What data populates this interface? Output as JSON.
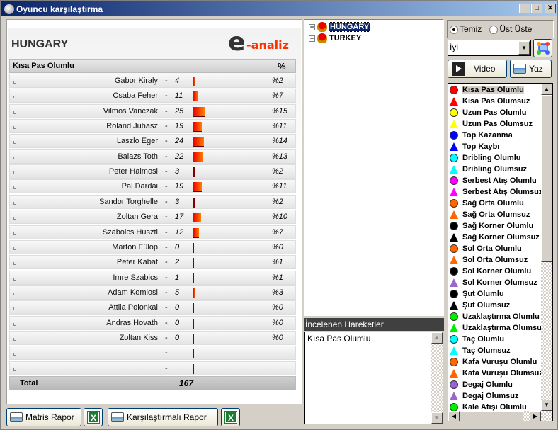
{
  "window": {
    "title": "Oyuncu karşılaştırma",
    "minimize": "_",
    "maximize": "□",
    "close": "✕"
  },
  "report": {
    "team": "HUNGARY",
    "logo_e": "e",
    "logo_text": "-analiz",
    "header": {
      "action": "Kısa Pas Olumlu",
      "pct": "%"
    },
    "rows": [
      {
        "name": "Gabor Kiraly",
        "value": "4",
        "pct": "%2"
      },
      {
        "name": "Csaba Feher",
        "value": "11",
        "pct": "%7"
      },
      {
        "name": "Vilmos Vanczak",
        "value": "25",
        "pct": "%15"
      },
      {
        "name": "Roland Juhasz",
        "value": "19",
        "pct": "%11"
      },
      {
        "name": "Laszlo Eger",
        "value": "24",
        "pct": "%14"
      },
      {
        "name": "Balazs Toth",
        "value": "22",
        "pct": "%13"
      },
      {
        "name": "Peter Halmosi",
        "value": "3",
        "pct": "%2"
      },
      {
        "name": "Pal Dardai",
        "value": "19",
        "pct": "%11"
      },
      {
        "name": "Sandor Torghelle",
        "value": "3",
        "pct": "%2"
      },
      {
        "name": "Zoltan Gera",
        "value": "17",
        "pct": "%10"
      },
      {
        "name": "Szabolcs Huszti",
        "value": "12",
        "pct": "%7"
      },
      {
        "name": "Marton Fülop",
        "value": "0",
        "pct": "%0"
      },
      {
        "name": "Peter Kabat",
        "value": "2",
        "pct": "%1"
      },
      {
        "name": "Imre Szabics",
        "value": "1",
        "pct": "%1"
      },
      {
        "name": "Adam Komlosi",
        "value": "5",
        "pct": "%3"
      },
      {
        "name": "Attila Polonkai",
        "value": "0",
        "pct": "%0"
      },
      {
        "name": "Andras Hovath",
        "value": "0",
        "pct": "%0"
      },
      {
        "name": "Zoltan Kiss",
        "value": "0",
        "pct": "%0"
      },
      {
        "name": "",
        "value": "",
        "pct": ""
      },
      {
        "name": "",
        "value": "",
        "pct": ""
      }
    ],
    "total_label": "Total",
    "total_value": "167",
    "dash": "-"
  },
  "buttons": {
    "matris": "Matris Rapor",
    "excel": "X",
    "karsilastirmali": "Karşılaştırmalı Rapor",
    "video": "Video",
    "yaz": "Yaz"
  },
  "tree": [
    {
      "label": "HUNGARY",
      "selected": true
    },
    {
      "label": "TURKEY",
      "selected": false
    }
  ],
  "tree_expand": "+",
  "incelenen": {
    "label": "İncelenen Hareketler",
    "items": [
      "Kısa Pas Olumlu"
    ]
  },
  "options": {
    "temiz": "Temiz",
    "ust_uste": "Üst Üste",
    "selected": "Temiz"
  },
  "combo": {
    "value": "İyi",
    "arrow": "▼"
  },
  "scroll": {
    "up": "▲",
    "down": "▼",
    "left": "◀",
    "right": "▶"
  },
  "actions": [
    {
      "label": "Kısa Pas Olumlu",
      "shape": "circle",
      "color": "#ff0000",
      "selected": true
    },
    {
      "label": "Kısa Pas Olumsuz",
      "shape": "triangle",
      "color": "#ff0000"
    },
    {
      "label": "Uzun Pas Olumlu",
      "shape": "circle",
      "color": "#ffff00"
    },
    {
      "label": "Uzun Pas Olumsuz",
      "shape": "triangle",
      "color": "#ffff00"
    },
    {
      "label": "Top Kazanma",
      "shape": "circle",
      "color": "#0000ff"
    },
    {
      "label": "Top Kaybı",
      "shape": "triangle",
      "color": "#0000ff"
    },
    {
      "label": "Dribling Olumlu",
      "shape": "circle",
      "color": "#00ffff"
    },
    {
      "label": "Dribling Olumsuz",
      "shape": "triangle",
      "color": "#00ffff"
    },
    {
      "label": "Serbest Atış Olumlu",
      "shape": "circle",
      "color": "#ff00ff"
    },
    {
      "label": "Serbest Atış Olumsuz",
      "shape": "triangle",
      "color": "#ff00ff"
    },
    {
      "label": "Sağ Orta Olumlu",
      "shape": "circle",
      "color": "#ff6600"
    },
    {
      "label": "Sağ Orta Olumsuz",
      "shape": "triangle",
      "color": "#ff6600"
    },
    {
      "label": "Sağ Korner Olumlu",
      "shape": "circle",
      "color": "#000000"
    },
    {
      "label": "Sağ Korner Olumsuz",
      "shape": "triangle",
      "color": "#000000"
    },
    {
      "label": "Sol Orta Olumlu",
      "shape": "circle",
      "color": "#ff6600"
    },
    {
      "label": "Sol Orta Olumsuz",
      "shape": "triangle",
      "color": "#ff6600"
    },
    {
      "label": "Sol Korner Olumlu",
      "shape": "circle",
      "color": "#000000"
    },
    {
      "label": "Sol Korner Olumsuz",
      "shape": "triangle",
      "color": "#9966cc"
    },
    {
      "label": "Şut Olumlu",
      "shape": "circle",
      "color": "#000000"
    },
    {
      "label": "Şut Olumsuz",
      "shape": "triangle",
      "color": "#000000"
    },
    {
      "label": "Uzaklaştırma Olumlu",
      "shape": "circle",
      "color": "#00ee00"
    },
    {
      "label": "Uzaklaştırma Olumsuz",
      "shape": "triangle",
      "color": "#00ee00"
    },
    {
      "label": "Taç Olumlu",
      "shape": "circle",
      "color": "#00ffff"
    },
    {
      "label": "Taç Olumsuz",
      "shape": "triangle",
      "color": "#00ffff"
    },
    {
      "label": "Kafa Vuruşu Olumlu",
      "shape": "circle",
      "color": "#ff6600"
    },
    {
      "label": "Kafa Vuruşu Olumsuz",
      "shape": "triangle",
      "color": "#ff6600"
    },
    {
      "label": "Degaj Olumlu",
      "shape": "circle",
      "color": "#9966cc"
    },
    {
      "label": "Degaj Olumsuz",
      "shape": "triangle",
      "color": "#9966cc"
    },
    {
      "label": "Kale Atışı Olumlu",
      "shape": "circle",
      "color": "#00ee00"
    }
  ]
}
